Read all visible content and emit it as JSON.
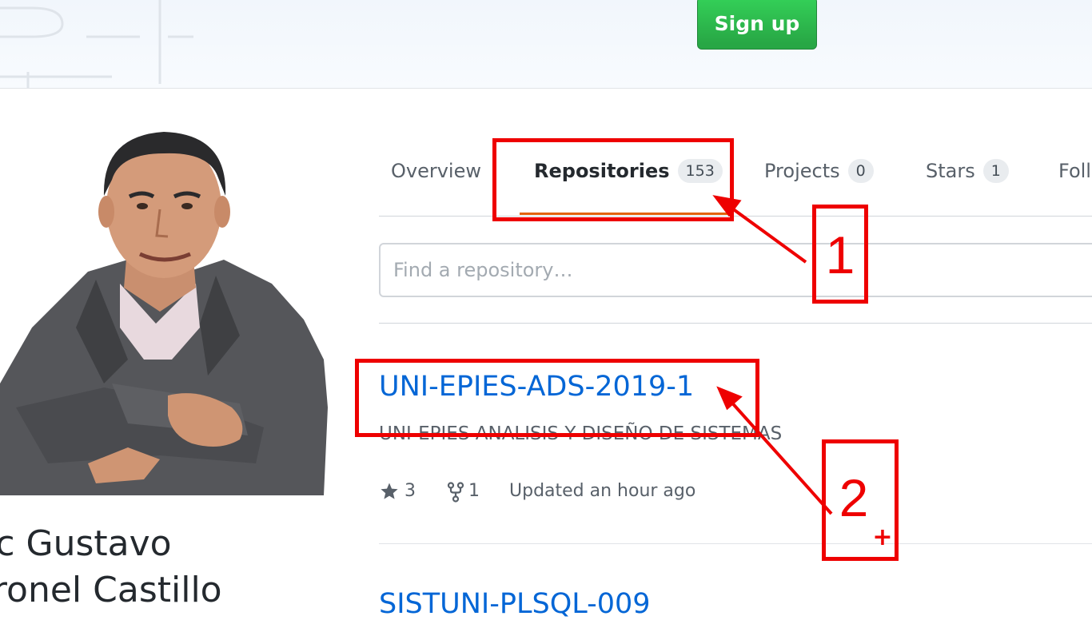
{
  "header": {
    "signup_label": "Sign up"
  },
  "profile": {
    "name_line1": "ric Gustavo",
    "name_line2": "oronel Castillo"
  },
  "tabs": [
    {
      "label": "Overview",
      "count": null,
      "selected": false
    },
    {
      "label": "Repositories",
      "count": "153",
      "selected": true
    },
    {
      "label": "Projects",
      "count": "0",
      "selected": false
    },
    {
      "label": "Stars",
      "count": "1",
      "selected": false
    },
    {
      "label": "Foll",
      "count": null,
      "selected": false
    }
  ],
  "search": {
    "placeholder": "Find a repository…"
  },
  "repositories": [
    {
      "name": "UNI-EPIES-ADS-2019-1",
      "description": "UNI-EPIES ANALISIS Y DISEÑO DE SISTEMAS",
      "stars": "3",
      "forks": "1",
      "updated": "Updated an hour ago"
    },
    {
      "name": "SISTUNI-PLSQL-009"
    }
  ],
  "annotations": {
    "label1": "1",
    "label2": "2",
    "cursor": "+"
  },
  "colors": {
    "accent_link": "#0366d6",
    "signup_green": "#28a745",
    "tab_underline": "#e36209",
    "annotation_red": "#ee0000"
  },
  "icons": [
    "star-icon",
    "fork-icon",
    "crosshair-cursor-icon"
  ]
}
